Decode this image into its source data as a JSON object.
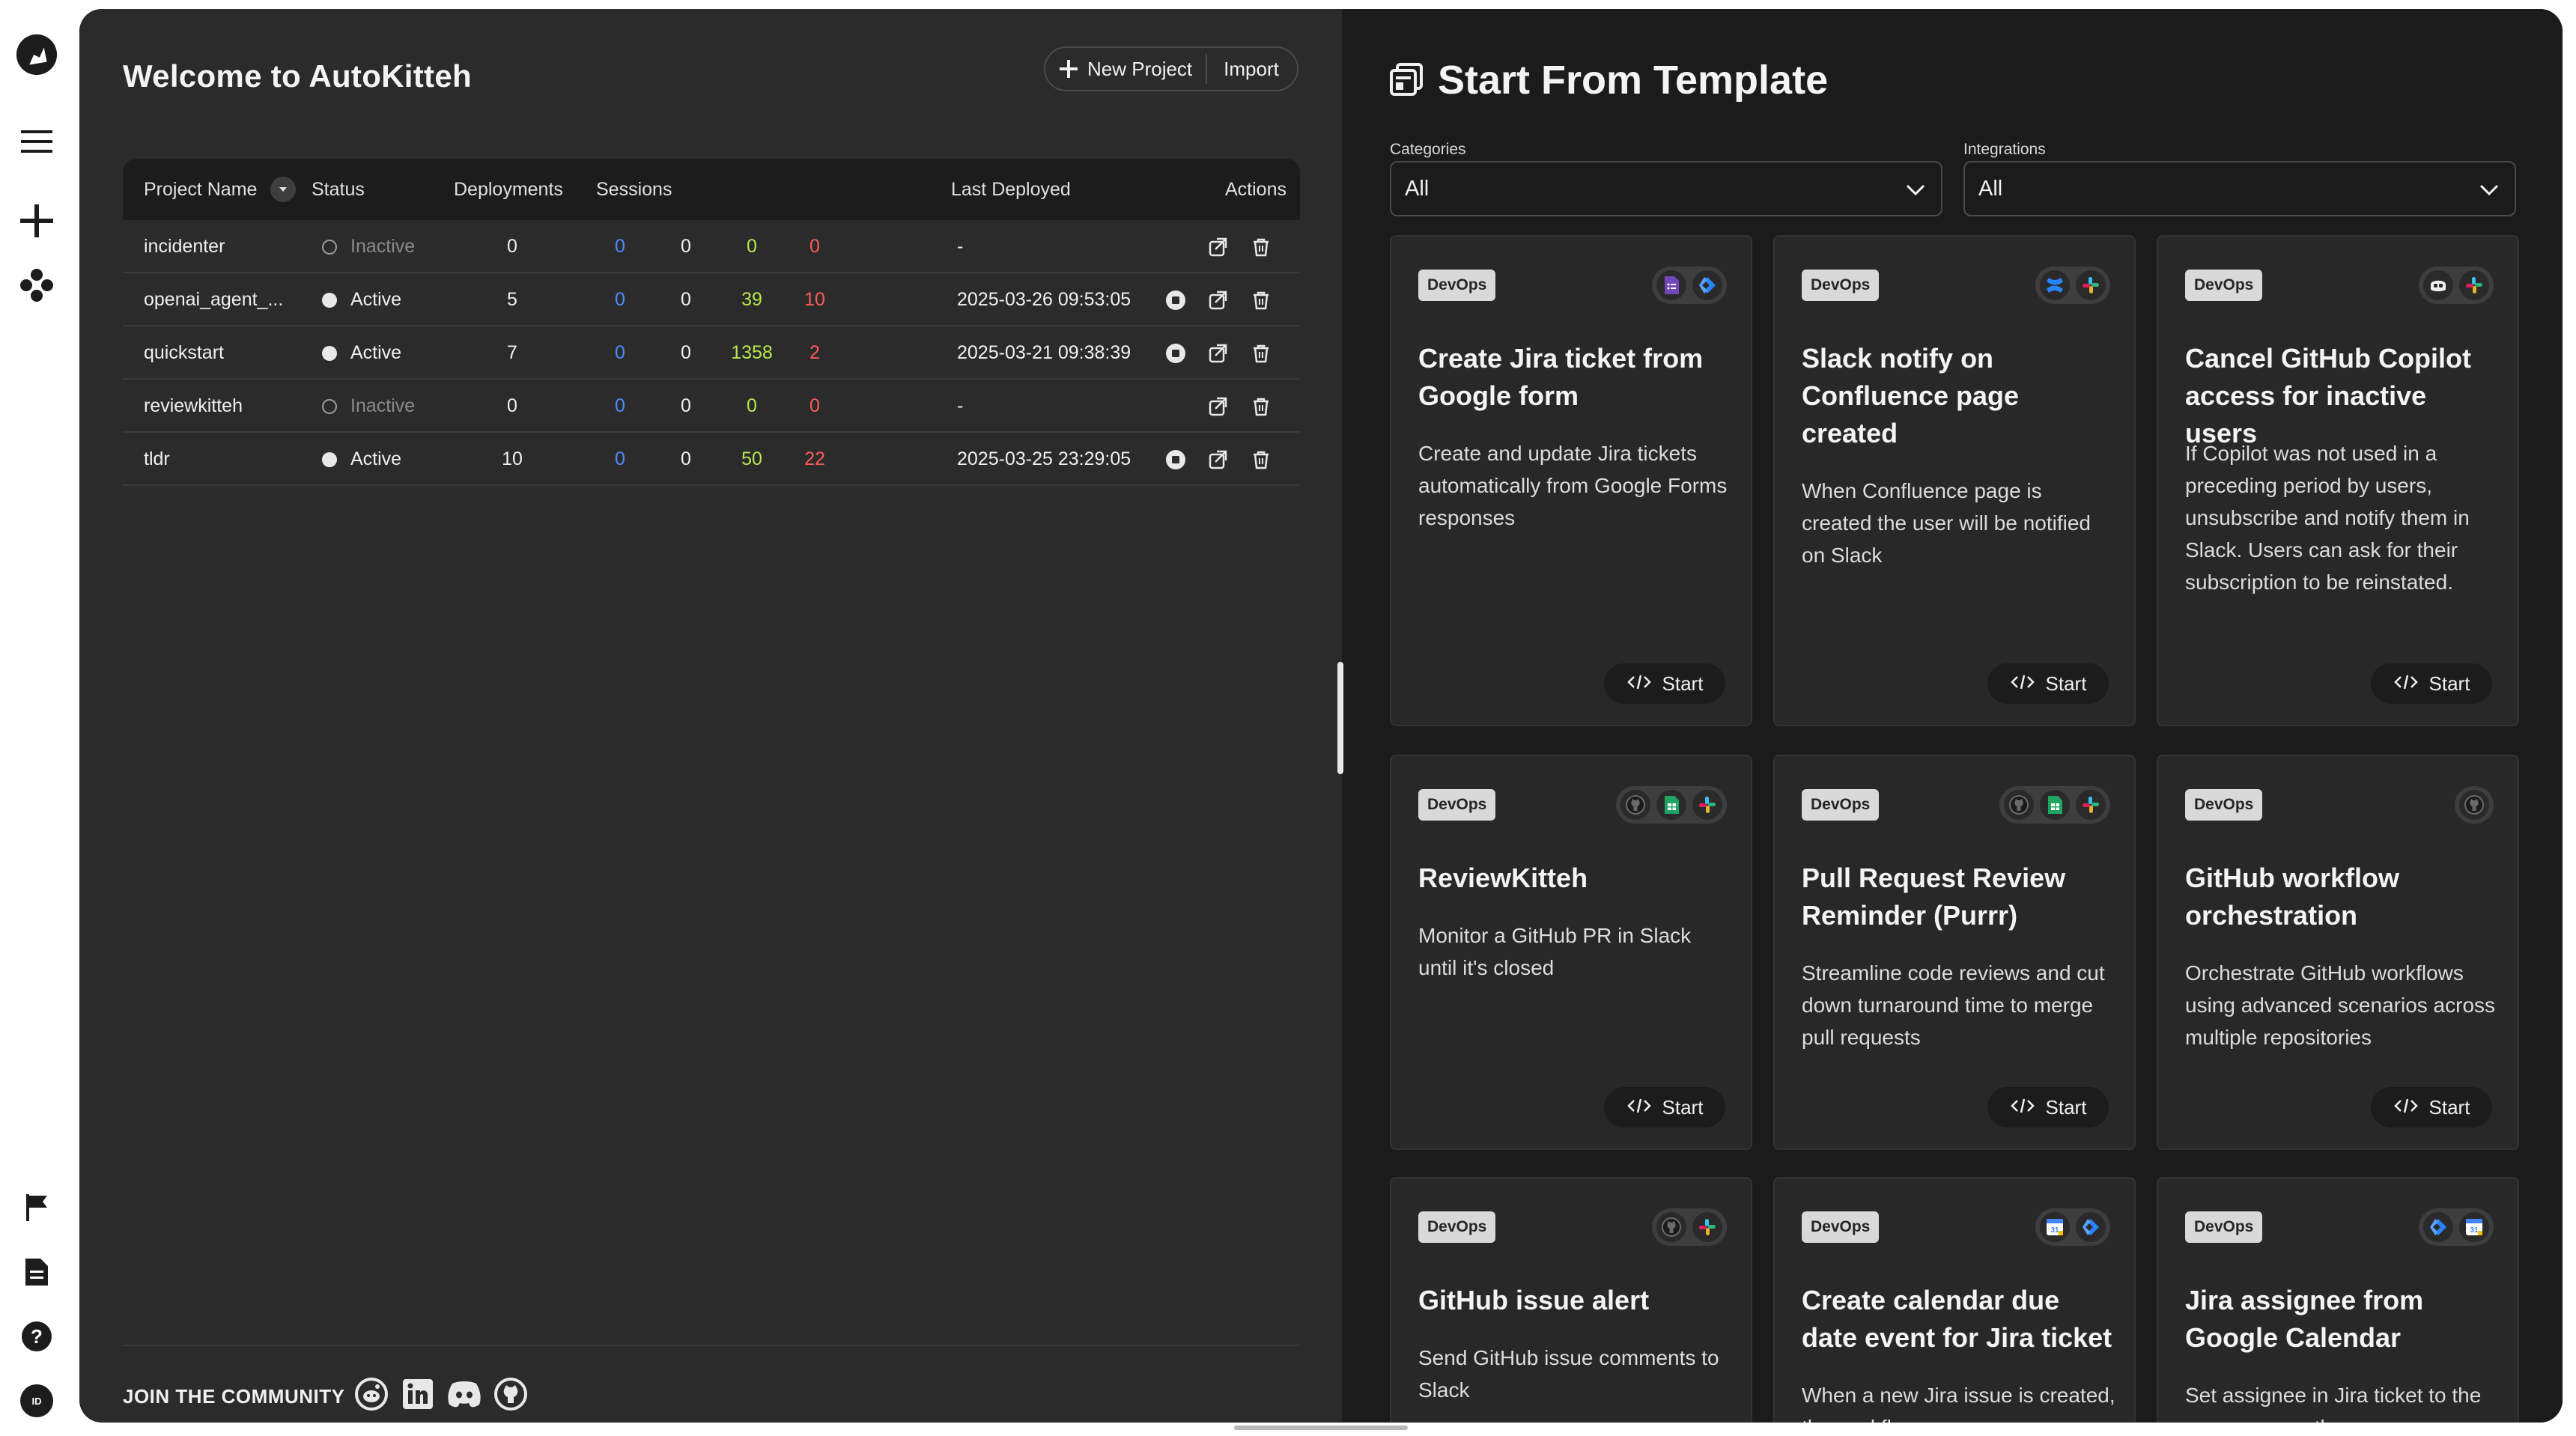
{
  "header": {
    "welcome": "Welcome to AutoKitteh",
    "new_project": "New Project",
    "import": "Import"
  },
  "table": {
    "columns": [
      "Project Name",
      "Status",
      "Deployments",
      "Sessions",
      "Last Deployed",
      "Actions"
    ],
    "rows": [
      {
        "name": "incidenter",
        "status": "Inactive",
        "deployments": "0",
        "s1": "0",
        "s2": "0",
        "s3": "0",
        "s4": "0",
        "last": "-"
      },
      {
        "name": "openai_agent_...",
        "status": "Active",
        "deployments": "5",
        "s1": "0",
        "s2": "0",
        "s3": "39",
        "s4": "10",
        "last": "2025-03-26 09:53:05"
      },
      {
        "name": "quickstart",
        "status": "Active",
        "deployments": "7",
        "s1": "0",
        "s2": "0",
        "s3": "1358",
        "s4": "2",
        "last": "2025-03-21 09:38:39"
      },
      {
        "name": "reviewkitteh",
        "status": "Inactive",
        "deployments": "0",
        "s1": "0",
        "s2": "0",
        "s3": "0",
        "s4": "0",
        "last": "-"
      },
      {
        "name": "tldr",
        "status": "Active",
        "deployments": "10",
        "s1": "0",
        "s2": "0",
        "s3": "50",
        "s4": "22",
        "last": "2025-03-25 23:29:05"
      }
    ]
  },
  "footer": {
    "community": "JOIN THE COMMUNITY",
    "social_icons": [
      "reddit-icon",
      "linkedin-icon",
      "discord-icon",
      "github-icon"
    ]
  },
  "templates": {
    "title": "Start From Template",
    "categories_label": "Categories",
    "categories_value": "All",
    "integrations_label": "Integrations",
    "integrations_value": "All",
    "start_label": "Start",
    "cards": [
      {
        "tag": "DevOps",
        "title": "Create Jira ticket from Google form",
        "desc": "Create and update Jira tickets automatically from Google Forms responses",
        "icons": [
          "google-forms-icon",
          "jira-icon"
        ]
      },
      {
        "tag": "DevOps",
        "title": "Slack notify on Confluence page created",
        "desc": "When Confluence page is created the user will be notified on Slack",
        "icons": [
          "confluence-icon",
          "slack-icon"
        ]
      },
      {
        "tag": "DevOps",
        "title": "Cancel GitHub Copilot access for inactive users",
        "desc": "If Copilot was not used in a preceding period by users, unsubscribe and notify them in Slack. Users can ask for their subscription to be reinstated.",
        "icons": [
          "copilot-icon",
          "slack-icon"
        ]
      },
      {
        "tag": "DevOps",
        "title": "ReviewKitteh",
        "desc": "Monitor a GitHub PR in Slack until it's closed",
        "icons": [
          "github-icon",
          "google-sheets-icon",
          "slack-icon"
        ]
      },
      {
        "tag": "DevOps",
        "title": "Pull Request Review Reminder (Purrr)",
        "desc": "Streamline code reviews and cut down turnaround time to merge pull requests",
        "icons": [
          "github-icon",
          "google-sheets-icon",
          "slack-icon"
        ]
      },
      {
        "tag": "DevOps",
        "title": "GitHub workflow orchestration",
        "desc": "Orchestrate GitHub workflows using advanced scenarios across multiple repositories",
        "icons": [
          "github-icon"
        ]
      },
      {
        "tag": "DevOps",
        "title": "GitHub issue alert",
        "desc": "Send GitHub issue comments to Slack",
        "icons": [
          "github-icon",
          "slack-icon"
        ]
      },
      {
        "tag": "DevOps",
        "title": "Create calendar due date event for Jira ticket",
        "desc": "When a new Jira issue is created, the workflow",
        "icons": [
          "google-calendar-icon",
          "jira-icon"
        ]
      },
      {
        "tag": "DevOps",
        "title": "Jira assignee from Google Calendar",
        "desc": "Set assignee in Jira ticket to the person currently",
        "icons": [
          "jira-icon",
          "google-calendar-icon"
        ]
      }
    ]
  },
  "colors": {
    "active_green": "#b6e84a",
    "error_red": "#ff5a5a",
    "info_blue": "#4a8cff"
  },
  "nav": {
    "icons": [
      "autokitteh-logo-icon",
      "menu-icon",
      "add-project-icon",
      "integrations-icon",
      "flag-icon",
      "docs-icon",
      "help-icon",
      "user-avatar-icon"
    ]
  }
}
